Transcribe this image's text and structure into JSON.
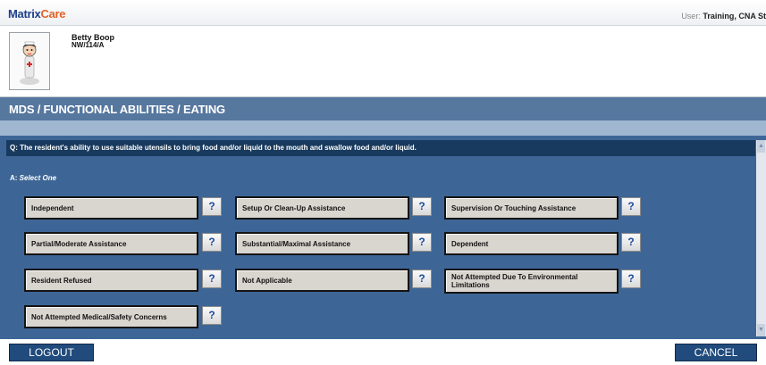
{
  "app": {
    "logo_part1": "Matrix",
    "logo_part2": "Care",
    "user_label": "User: ",
    "user_name": "Training, CNA St"
  },
  "resident": {
    "name": "Betty Boop",
    "room": "NW/114/A"
  },
  "header": {
    "breadcrumb": "MDS / FUNCTIONAL ABILITIES / EATING"
  },
  "question": {
    "text": "Q: The resident's ability to use suitable utensils to bring food and/or liquid to the mouth and swallow food and/or liquid."
  },
  "answer": {
    "prefix": "A: ",
    "instruction": "Select One"
  },
  "options": [
    "Independent",
    "Setup Or Clean-Up Assistance",
    "Supervision Or Touching Assistance",
    "Partial/Moderate Assistance",
    "Substantial/Maximal Assistance",
    "Dependent",
    "Resident Refused",
    "Not Applicable",
    "Not Attempted Due To Environmental Limitations",
    "Not Attempted Medical/Safety Concerns"
  ],
  "help_label": "?",
  "footer": {
    "logout_label": "LOGOUT",
    "cancel_label": "CANCEL"
  },
  "colors": {
    "header_band": "#56779e",
    "main_panel": "#3d6696",
    "question_bar": "#183a5e",
    "button_face": "#d9d5cf",
    "footer_button": "#204b7c"
  }
}
